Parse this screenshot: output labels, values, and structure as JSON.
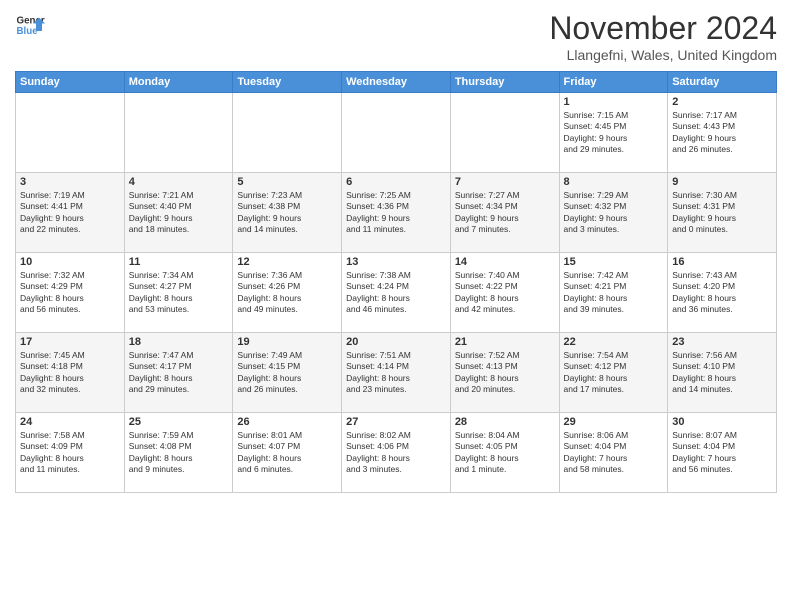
{
  "logo": {
    "line1": "General",
    "line2": "Blue"
  },
  "title": "November 2024",
  "subtitle": "Llangefni, Wales, United Kingdom",
  "weekdays": [
    "Sunday",
    "Monday",
    "Tuesday",
    "Wednesday",
    "Thursday",
    "Friday",
    "Saturday"
  ],
  "weeks": [
    [
      {
        "day": "",
        "info": ""
      },
      {
        "day": "",
        "info": ""
      },
      {
        "day": "",
        "info": ""
      },
      {
        "day": "",
        "info": ""
      },
      {
        "day": "",
        "info": ""
      },
      {
        "day": "1",
        "info": "Sunrise: 7:15 AM\nSunset: 4:45 PM\nDaylight: 9 hours\nand 29 minutes."
      },
      {
        "day": "2",
        "info": "Sunrise: 7:17 AM\nSunset: 4:43 PM\nDaylight: 9 hours\nand 26 minutes."
      }
    ],
    [
      {
        "day": "3",
        "info": "Sunrise: 7:19 AM\nSunset: 4:41 PM\nDaylight: 9 hours\nand 22 minutes."
      },
      {
        "day": "4",
        "info": "Sunrise: 7:21 AM\nSunset: 4:40 PM\nDaylight: 9 hours\nand 18 minutes."
      },
      {
        "day": "5",
        "info": "Sunrise: 7:23 AM\nSunset: 4:38 PM\nDaylight: 9 hours\nand 14 minutes."
      },
      {
        "day": "6",
        "info": "Sunrise: 7:25 AM\nSunset: 4:36 PM\nDaylight: 9 hours\nand 11 minutes."
      },
      {
        "day": "7",
        "info": "Sunrise: 7:27 AM\nSunset: 4:34 PM\nDaylight: 9 hours\nand 7 minutes."
      },
      {
        "day": "8",
        "info": "Sunrise: 7:29 AM\nSunset: 4:32 PM\nDaylight: 9 hours\nand 3 minutes."
      },
      {
        "day": "9",
        "info": "Sunrise: 7:30 AM\nSunset: 4:31 PM\nDaylight: 9 hours\nand 0 minutes."
      }
    ],
    [
      {
        "day": "10",
        "info": "Sunrise: 7:32 AM\nSunset: 4:29 PM\nDaylight: 8 hours\nand 56 minutes."
      },
      {
        "day": "11",
        "info": "Sunrise: 7:34 AM\nSunset: 4:27 PM\nDaylight: 8 hours\nand 53 minutes."
      },
      {
        "day": "12",
        "info": "Sunrise: 7:36 AM\nSunset: 4:26 PM\nDaylight: 8 hours\nand 49 minutes."
      },
      {
        "day": "13",
        "info": "Sunrise: 7:38 AM\nSunset: 4:24 PM\nDaylight: 8 hours\nand 46 minutes."
      },
      {
        "day": "14",
        "info": "Sunrise: 7:40 AM\nSunset: 4:22 PM\nDaylight: 8 hours\nand 42 minutes."
      },
      {
        "day": "15",
        "info": "Sunrise: 7:42 AM\nSunset: 4:21 PM\nDaylight: 8 hours\nand 39 minutes."
      },
      {
        "day": "16",
        "info": "Sunrise: 7:43 AM\nSunset: 4:20 PM\nDaylight: 8 hours\nand 36 minutes."
      }
    ],
    [
      {
        "day": "17",
        "info": "Sunrise: 7:45 AM\nSunset: 4:18 PM\nDaylight: 8 hours\nand 32 minutes."
      },
      {
        "day": "18",
        "info": "Sunrise: 7:47 AM\nSunset: 4:17 PM\nDaylight: 8 hours\nand 29 minutes."
      },
      {
        "day": "19",
        "info": "Sunrise: 7:49 AM\nSunset: 4:15 PM\nDaylight: 8 hours\nand 26 minutes."
      },
      {
        "day": "20",
        "info": "Sunrise: 7:51 AM\nSunset: 4:14 PM\nDaylight: 8 hours\nand 23 minutes."
      },
      {
        "day": "21",
        "info": "Sunrise: 7:52 AM\nSunset: 4:13 PM\nDaylight: 8 hours\nand 20 minutes."
      },
      {
        "day": "22",
        "info": "Sunrise: 7:54 AM\nSunset: 4:12 PM\nDaylight: 8 hours\nand 17 minutes."
      },
      {
        "day": "23",
        "info": "Sunrise: 7:56 AM\nSunset: 4:10 PM\nDaylight: 8 hours\nand 14 minutes."
      }
    ],
    [
      {
        "day": "24",
        "info": "Sunrise: 7:58 AM\nSunset: 4:09 PM\nDaylight: 8 hours\nand 11 minutes."
      },
      {
        "day": "25",
        "info": "Sunrise: 7:59 AM\nSunset: 4:08 PM\nDaylight: 8 hours\nand 9 minutes."
      },
      {
        "day": "26",
        "info": "Sunrise: 8:01 AM\nSunset: 4:07 PM\nDaylight: 8 hours\nand 6 minutes."
      },
      {
        "day": "27",
        "info": "Sunrise: 8:02 AM\nSunset: 4:06 PM\nDaylight: 8 hours\nand 3 minutes."
      },
      {
        "day": "28",
        "info": "Sunrise: 8:04 AM\nSunset: 4:05 PM\nDaylight: 8 hours\nand 1 minute."
      },
      {
        "day": "29",
        "info": "Sunrise: 8:06 AM\nSunset: 4:04 PM\nDaylight: 7 hours\nand 58 minutes."
      },
      {
        "day": "30",
        "info": "Sunrise: 8:07 AM\nSunset: 4:04 PM\nDaylight: 7 hours\nand 56 minutes."
      }
    ]
  ]
}
